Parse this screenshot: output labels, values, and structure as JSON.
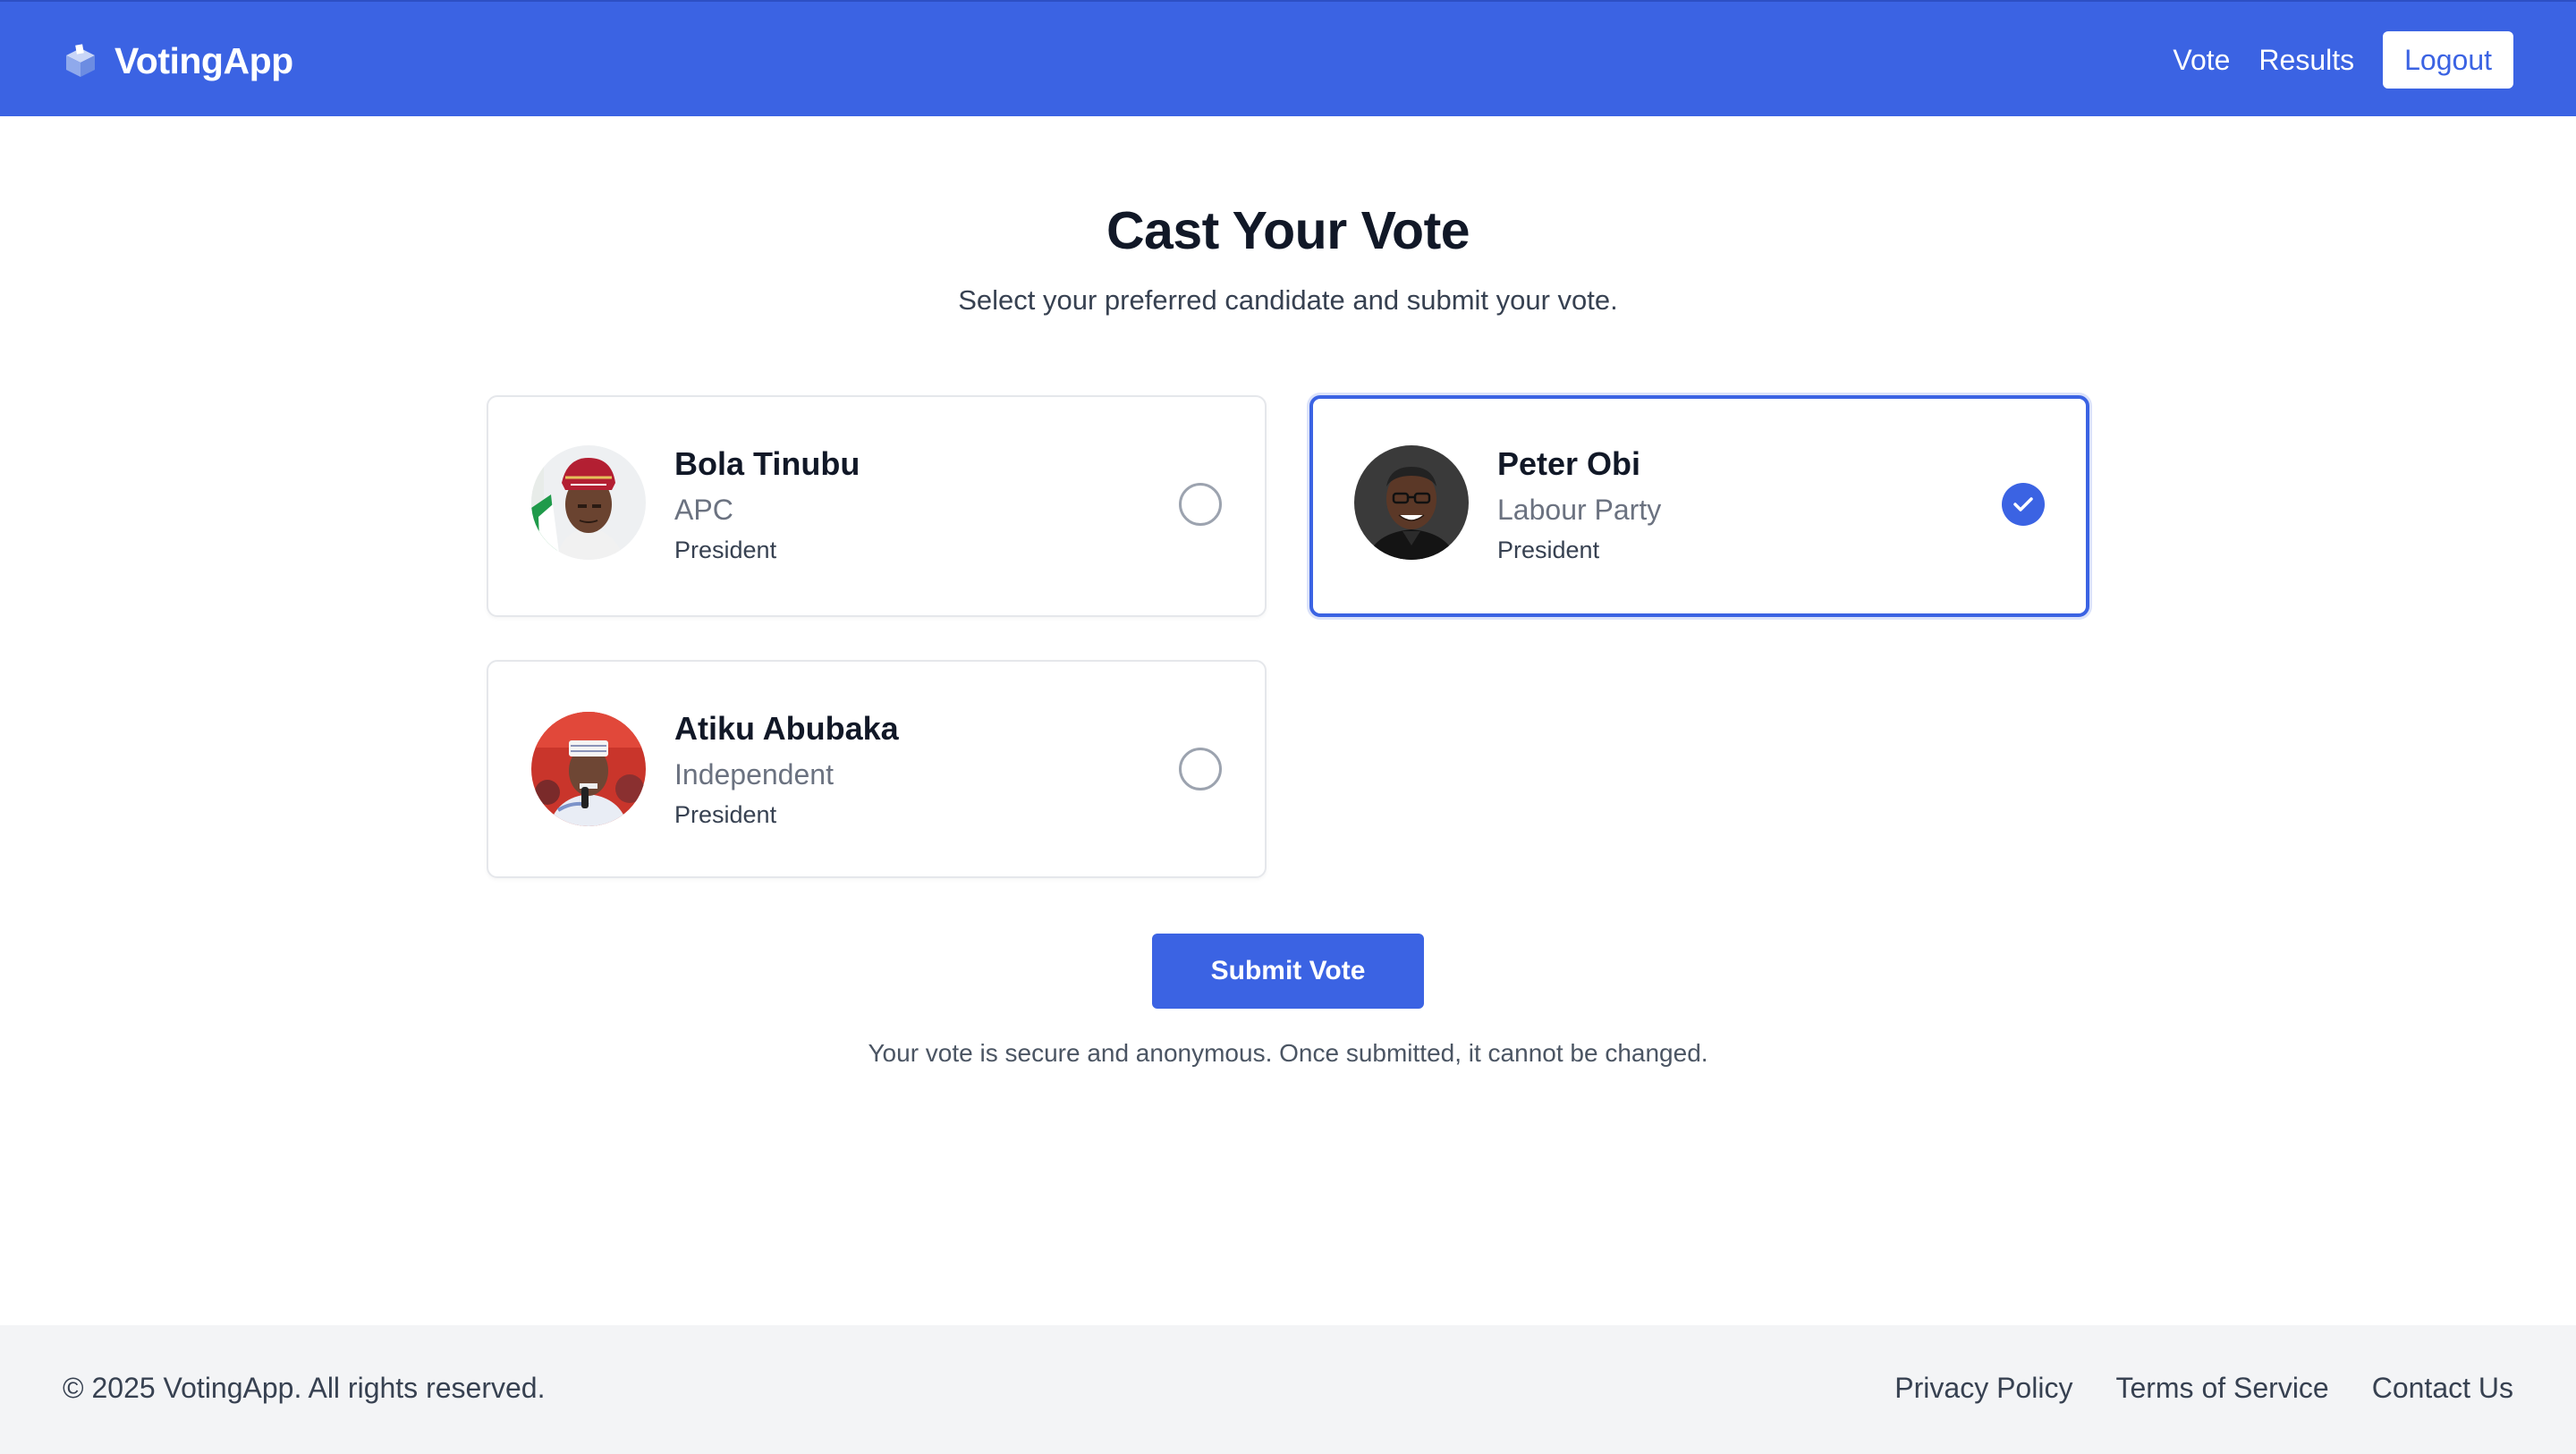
{
  "header": {
    "brand_icon": "ballot-box-icon",
    "brand": "VotingApp",
    "nav": [
      {
        "label": "Vote"
      },
      {
        "label": "Results"
      }
    ],
    "logout_label": "Logout",
    "accent_color": "#3b63e3"
  },
  "main": {
    "title": "Cast Your Vote",
    "subtitle": "Select your preferred candidate and submit your vote.",
    "candidates": [
      {
        "name": "Bola Tinubu",
        "party": "APC",
        "role": "President",
        "selected": false,
        "avatar_icon": "candidate-photo"
      },
      {
        "name": "Peter Obi",
        "party": "Labour Party",
        "role": "President",
        "selected": true,
        "avatar_icon": "candidate-photo"
      },
      {
        "name": "Atiku Abubaka",
        "party": "Independent",
        "role": "President",
        "selected": false,
        "avatar_icon": "candidate-photo"
      }
    ],
    "submit_label": "Submit Vote",
    "note": "Your vote is secure and anonymous. Once submitted, it cannot be changed."
  },
  "footer": {
    "copyright": "© 2025 VotingApp. All rights reserved.",
    "links": [
      {
        "label": "Privacy Policy"
      },
      {
        "label": "Terms of Service"
      },
      {
        "label": "Contact Us"
      }
    ]
  }
}
